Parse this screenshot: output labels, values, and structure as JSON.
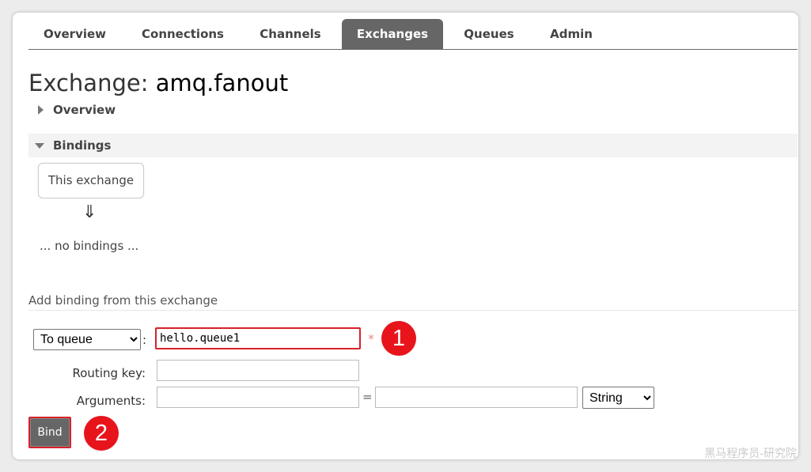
{
  "nav": {
    "tabs": [
      {
        "label": "Overview"
      },
      {
        "label": "Connections"
      },
      {
        "label": "Channels"
      },
      {
        "label": "Exchanges",
        "active": true
      },
      {
        "label": "Queues"
      },
      {
        "label": "Admin"
      }
    ]
  },
  "page": {
    "title_prefix": "Exchange:",
    "exchange_name": "amq.fanout"
  },
  "sections": {
    "overview_label": "Overview",
    "bindings_label": "Bindings"
  },
  "bindings": {
    "source_box": "This exchange",
    "arrow": "⇓",
    "empty_text": "... no bindings ..."
  },
  "add_binding": {
    "heading": "Add binding from this exchange",
    "destination_type": "To queue",
    "destination_options": [
      "To queue"
    ],
    "colon": ":",
    "destination_value": "hello.queue1",
    "required_mark": "*",
    "routing_key_label": "Routing key:",
    "routing_key_value": "",
    "arguments_label": "Arguments:",
    "equals": "=",
    "arg_key_value": "",
    "arg_value_value": "",
    "arg_type": "String",
    "arg_type_options": [
      "String"
    ],
    "bind_label": "Bind"
  },
  "annotations": {
    "marker_1": "1",
    "marker_2": "2",
    "marker_color": "#e8141c"
  },
  "watermark": "黑马程序员-研究院",
  "colors": {
    "active_tab_bg": "#666666",
    "highlight_border": "#d9202a"
  }
}
